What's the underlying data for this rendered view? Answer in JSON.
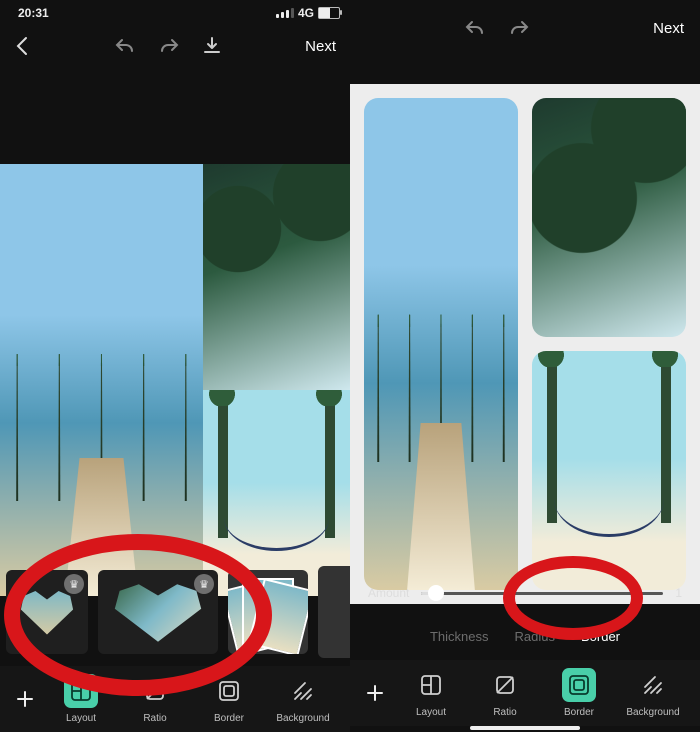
{
  "left": {
    "statusbar": {
      "time": "20:31",
      "network_label": "4G"
    },
    "topbar": {
      "next_label": "Next"
    },
    "templates": [
      {
        "id": "heart-small",
        "premium": true
      },
      {
        "id": "heart-large",
        "premium": true
      },
      {
        "id": "stack-3"
      },
      {
        "id": "grid-2x2"
      }
    ],
    "tools": {
      "plus": "+",
      "items": [
        {
          "id": "layout",
          "label": "Layout",
          "active": true
        },
        {
          "id": "ratio",
          "label": "Ratio",
          "active": false
        },
        {
          "id": "border",
          "label": "Border",
          "active": false
        },
        {
          "id": "background",
          "label": "Background",
          "active": false
        }
      ]
    }
  },
  "right": {
    "topbar": {
      "next_label": "Next"
    },
    "slider": {
      "label": "Amount",
      "value_label": "1",
      "percent": 6
    },
    "tabs": [
      {
        "id": "thickness",
        "label": "Thickness",
        "active": false
      },
      {
        "id": "radius",
        "label": "Radius",
        "active": false
      },
      {
        "id": "border",
        "label": "Border",
        "active": true
      }
    ],
    "tools": {
      "plus": "+",
      "items": [
        {
          "id": "layout",
          "label": "Layout",
          "active": false
        },
        {
          "id": "ratio",
          "label": "Ratio",
          "active": false
        },
        {
          "id": "border",
          "label": "Border",
          "active": true
        },
        {
          "id": "background",
          "label": "Background",
          "active": false
        }
      ]
    }
  },
  "icons": {
    "back": "‹",
    "undo": "↶",
    "redo": "↷",
    "download": "⭳",
    "crown": "♛",
    "plus": "＋"
  }
}
